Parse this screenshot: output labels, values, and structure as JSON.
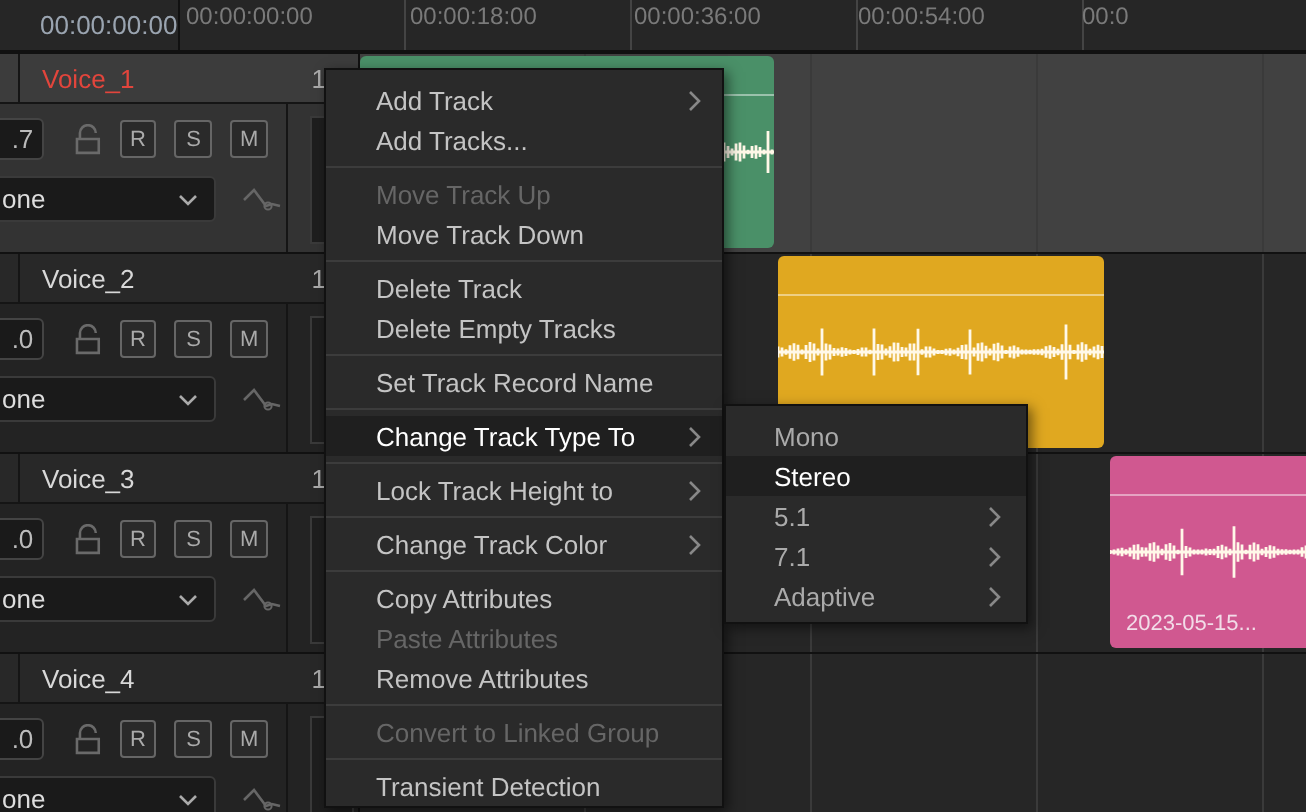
{
  "timecode": "00:00:00:00",
  "ruler": [
    "00:00:00:00",
    "00:00:18:00",
    "00:00:36:00",
    "00:00:54:00",
    "00:0"
  ],
  "tracks": [
    {
      "name": "Voice_1",
      "selected": true,
      "number": "1",
      "volume": ".7",
      "buttons": [
        "R",
        "S",
        "M"
      ],
      "routing": "one",
      "clip": {
        "color": "#4a9068"
      }
    },
    {
      "name": "Voice_2",
      "selected": false,
      "number": "1",
      "volume": ".0",
      "buttons": [
        "R",
        "S",
        "M"
      ],
      "routing": "one",
      "clip": {
        "color": "#e0a820"
      }
    },
    {
      "name": "Voice_3",
      "selected": false,
      "number": "1",
      "volume": ".0",
      "buttons": [
        "R",
        "S",
        "M"
      ],
      "routing": "one",
      "clip": {
        "color": "#d05890",
        "label": "2023-05-15..."
      }
    },
    {
      "name": "Voice_4",
      "selected": false,
      "number": "1",
      "volume": ".0",
      "buttons": [
        "R",
        "S",
        "M"
      ],
      "routing": "one"
    }
  ],
  "context_menu": [
    {
      "kind": "item",
      "label": "Add Track",
      "disabled": false,
      "submenu": true,
      "selected": false
    },
    {
      "kind": "item",
      "label": "Add Tracks...",
      "disabled": false,
      "submenu": false,
      "selected": false
    },
    {
      "kind": "separator"
    },
    {
      "kind": "item",
      "label": "Move Track Up",
      "disabled": true,
      "submenu": false,
      "selected": false
    },
    {
      "kind": "item",
      "label": "Move Track Down",
      "disabled": false,
      "submenu": false,
      "selected": false
    },
    {
      "kind": "separator"
    },
    {
      "kind": "item",
      "label": "Delete Track",
      "disabled": false,
      "submenu": false,
      "selected": false
    },
    {
      "kind": "item",
      "label": "Delete Empty Tracks",
      "disabled": false,
      "submenu": false,
      "selected": false
    },
    {
      "kind": "separator"
    },
    {
      "kind": "item",
      "label": "Set Track Record Name",
      "disabled": false,
      "submenu": false,
      "selected": false
    },
    {
      "kind": "separator"
    },
    {
      "kind": "item",
      "label": "Change Track Type To",
      "disabled": false,
      "submenu": true,
      "selected": true
    },
    {
      "kind": "separator"
    },
    {
      "kind": "item",
      "label": "Lock Track Height to",
      "disabled": false,
      "submenu": true,
      "selected": false
    },
    {
      "kind": "separator"
    },
    {
      "kind": "item",
      "label": "Change Track Color",
      "disabled": false,
      "submenu": true,
      "selected": false
    },
    {
      "kind": "separator"
    },
    {
      "kind": "item",
      "label": "Copy Attributes",
      "disabled": false,
      "submenu": false,
      "selected": false
    },
    {
      "kind": "item",
      "label": "Paste Attributes",
      "disabled": true,
      "submenu": false,
      "selected": false
    },
    {
      "kind": "item",
      "label": "Remove Attributes",
      "disabled": false,
      "submenu": false,
      "selected": false
    },
    {
      "kind": "separator"
    },
    {
      "kind": "item",
      "label": "Convert to Linked Group",
      "disabled": true,
      "submenu": false,
      "selected": false
    },
    {
      "kind": "separator"
    },
    {
      "kind": "item",
      "label": "Transient Detection",
      "disabled": false,
      "submenu": false,
      "selected": false
    }
  ],
  "submenu": [
    {
      "label": "Mono",
      "submenu": false,
      "selected": false
    },
    {
      "label": "Stereo",
      "submenu": false,
      "selected": true
    },
    {
      "label": "5.1",
      "submenu": true,
      "selected": false
    },
    {
      "label": "7.1",
      "submenu": true,
      "selected": false
    },
    {
      "label": "Adaptive",
      "submenu": true,
      "selected": false
    }
  ]
}
